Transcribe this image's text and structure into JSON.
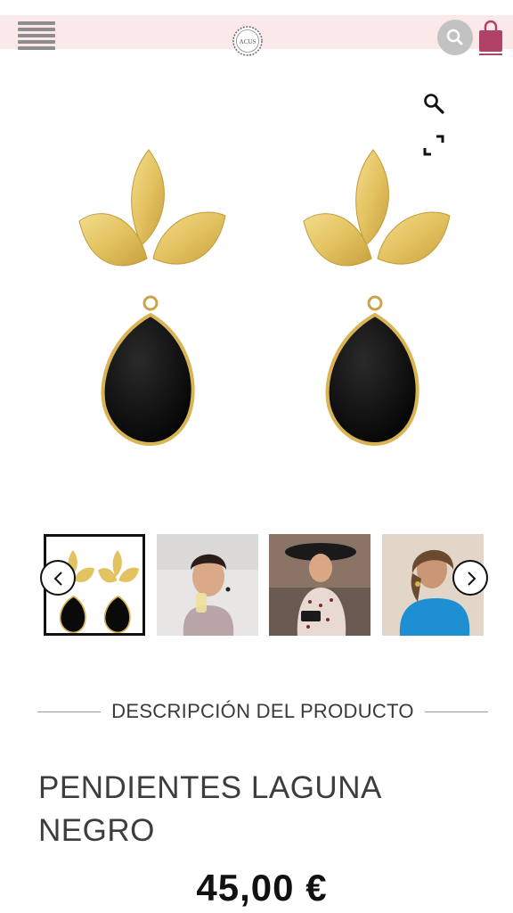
{
  "header": {
    "menu_icon": "hamburger-menu-icon",
    "logo_text": "ACUS",
    "search_icon": "search-icon",
    "bag_icon": "shopping-bag-icon",
    "colors": {
      "bar": "#fbe9ea",
      "bag": "#b0426a",
      "search_bg": "#c2c2c2"
    }
  },
  "gallery": {
    "zoom_icon": "magnifier-icon",
    "fullscreen_icon": "fullscreen-icon",
    "main_image": "earrings-gold-leaves-black-stone",
    "thumbnails": [
      {
        "label": "earrings-product"
      },
      {
        "label": "woman-drinking"
      },
      {
        "label": "woman-with-hat"
      },
      {
        "label": "woman-blue-dress"
      }
    ],
    "prev_icon": "chevron-left-icon",
    "next_icon": "chevron-right-icon"
  },
  "description": {
    "title": "DESCRIPCIÓN DEL PRODUCTO"
  },
  "product": {
    "name": "PENDIENTES LAGUNA NEGRO",
    "price": "45,00 €"
  }
}
